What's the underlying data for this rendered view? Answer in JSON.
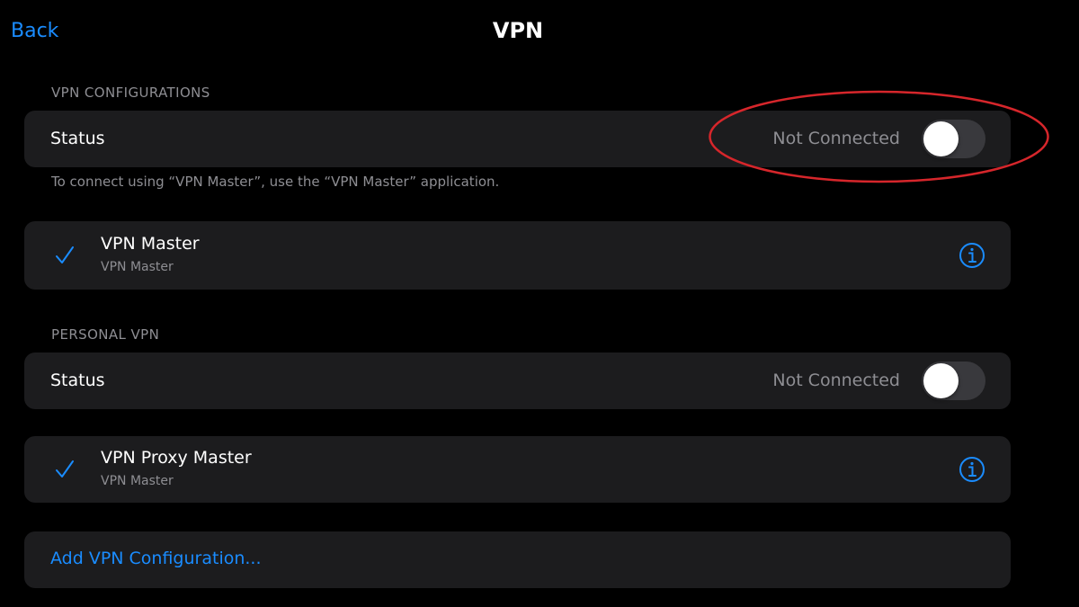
{
  "nav": {
    "back_label": "Back",
    "title": "VPN"
  },
  "vpn_configurations": {
    "header": "VPN CONFIGURATIONS",
    "status_label": "Status",
    "status_value": "Not Connected",
    "toggle_on": false,
    "footer_note": "To connect using “VPN Master”, use the “VPN Master” application.",
    "item": {
      "name": "VPN Master",
      "subtitle": "VPN Master",
      "selected": true
    }
  },
  "personal_vpn": {
    "header": "PERSONAL VPN",
    "status_label": "Status",
    "status_value": "Not Connected",
    "toggle_on": false,
    "item": {
      "name": "VPN Proxy Master",
      "subtitle": "VPN Master",
      "selected": true
    }
  },
  "add_configuration_label": "Add VPN Configuration...",
  "icons": {
    "check": "checkmark-icon",
    "info": "info-icon"
  },
  "colors": {
    "background": "#000000",
    "cell": "#1c1c1e",
    "accent": "#1a8cff",
    "secondary_text": "#8e8e93",
    "toggle_off": "#39393d",
    "annotation": "#d6262b"
  }
}
